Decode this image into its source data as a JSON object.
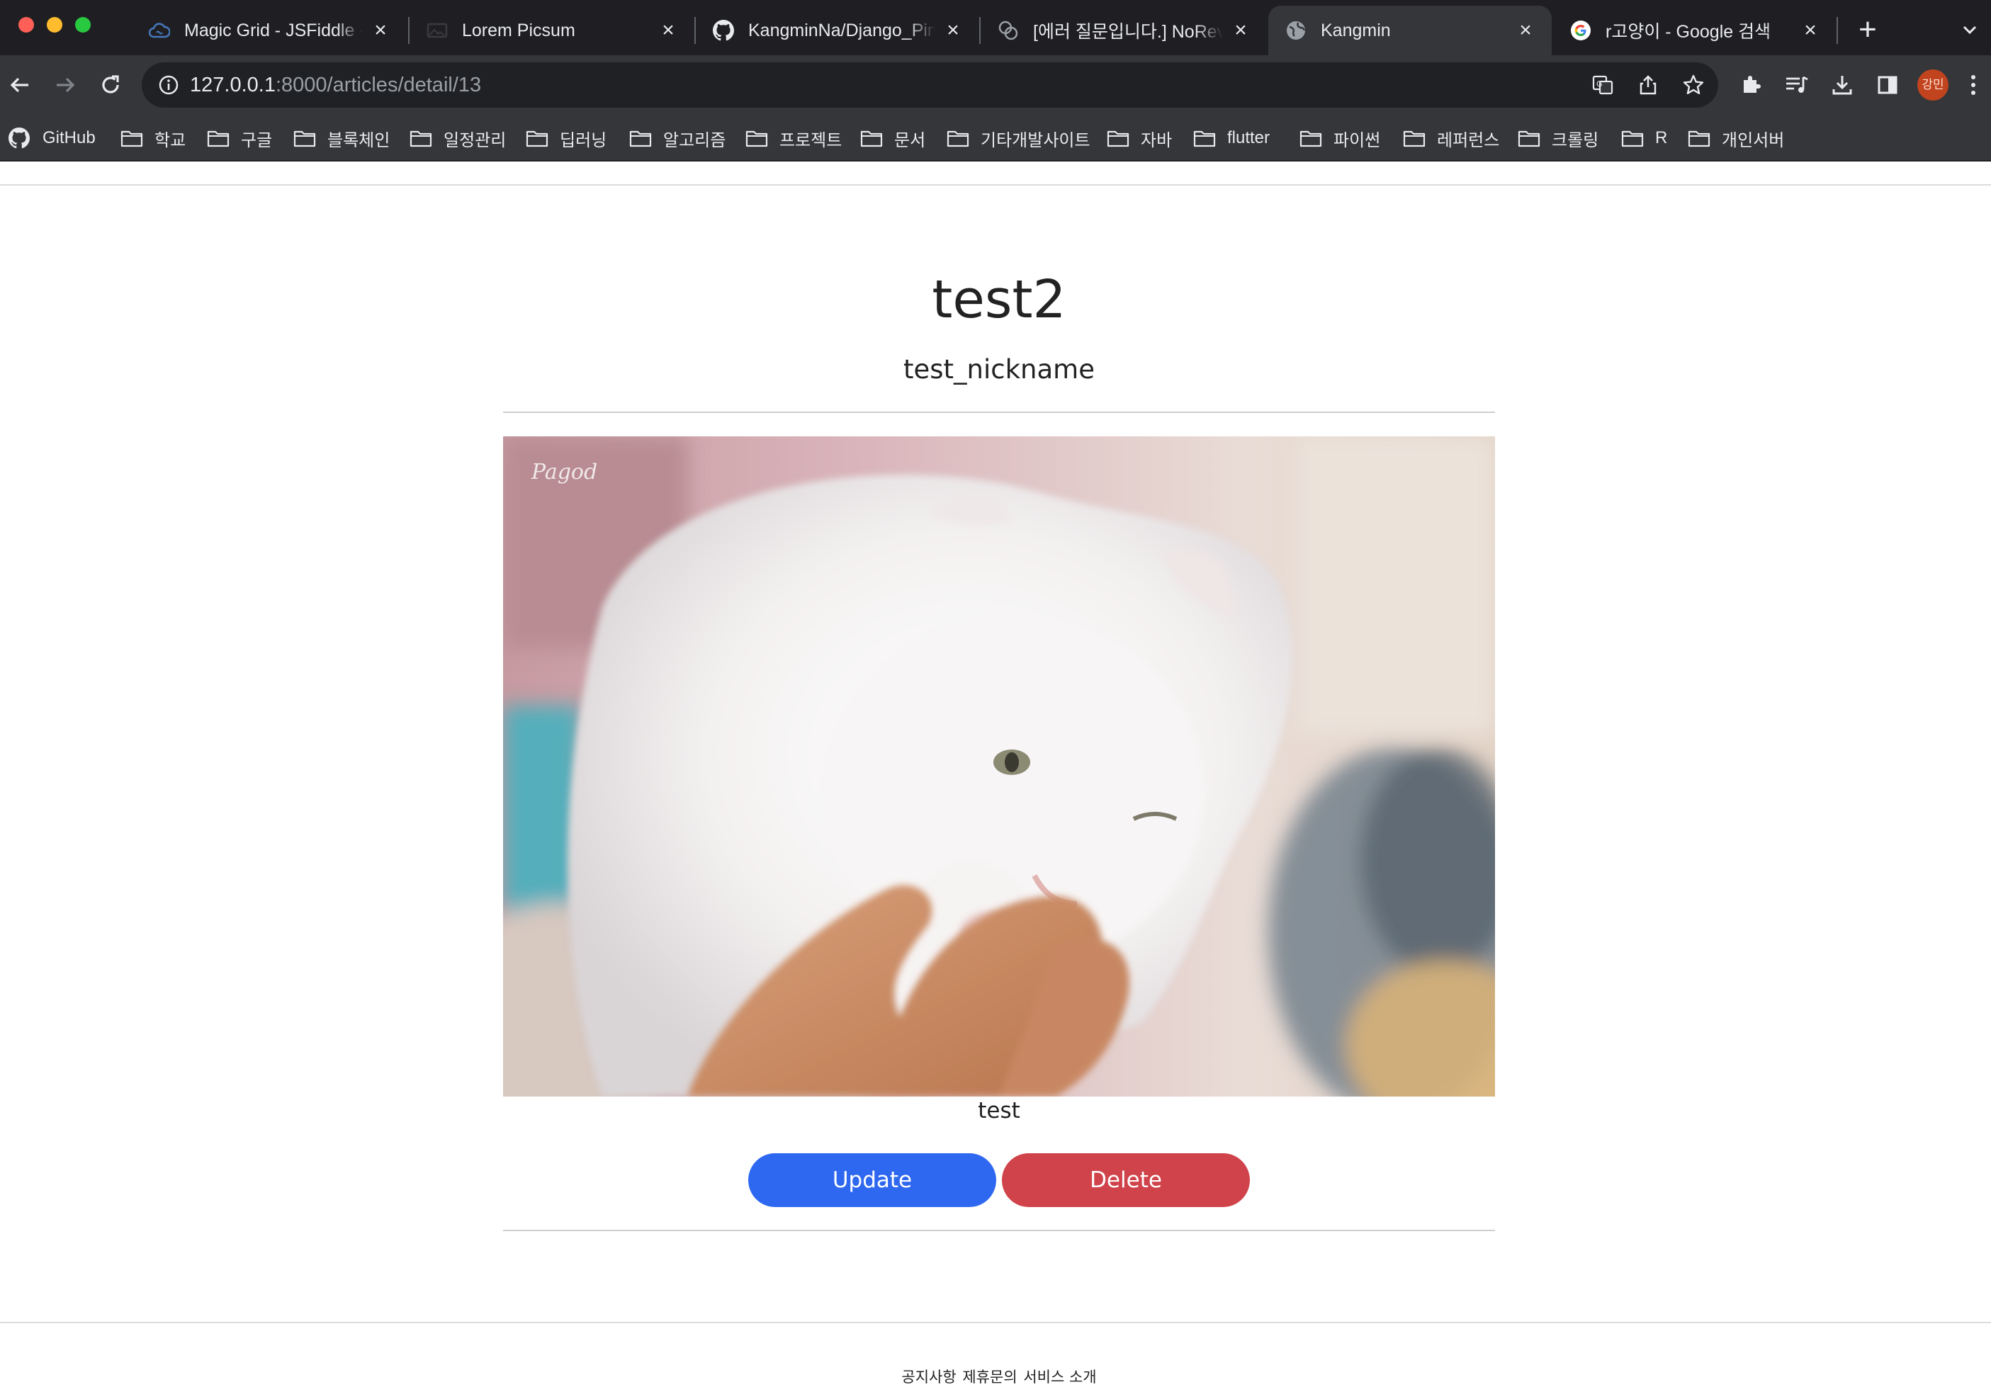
{
  "browser": {
    "tabs": [
      {
        "title": "Magic Grid - JSFiddle - Code Playground",
        "favicon": "jsfiddle-icon",
        "close": "×"
      },
      {
        "title": "Lorem Picsum",
        "favicon": "picsum-icon",
        "close": "×"
      },
      {
        "title": "KangminNa/Django_Pinterest",
        "favicon": "github-icon",
        "close": "×"
      },
      {
        "title": "[에러 질문입니다.] NoReverseMatch",
        "favicon": "translate-icon",
        "close": "×"
      },
      {
        "title": "Kangmin",
        "favicon": "globe-icon",
        "close": "×"
      },
      {
        "title": "r고양이 - Google 검색",
        "favicon": "google-icon",
        "close": "×"
      }
    ],
    "new_tab": "+",
    "url_host": "127.0.0.1",
    "url_rest": ":8000/articles/detail/13",
    "profile_initials": "강민",
    "bookmarks": [
      {
        "label": "GitHub",
        "icon": "github-icon"
      },
      {
        "label": "학교",
        "icon": "folder-icon"
      },
      {
        "label": "구글",
        "icon": "folder-icon"
      },
      {
        "label": "블록체인",
        "icon": "folder-icon"
      },
      {
        "label": "일정관리",
        "icon": "folder-icon"
      },
      {
        "label": "딥러닝",
        "icon": "folder-icon"
      },
      {
        "label": "알고리즘",
        "icon": "folder-icon"
      },
      {
        "label": "프로젝트",
        "icon": "folder-icon"
      },
      {
        "label": "문서",
        "icon": "folder-icon"
      },
      {
        "label": "기타개발사이트",
        "icon": "folder-icon"
      },
      {
        "label": "자바",
        "icon": "folder-icon"
      },
      {
        "label": "flutter",
        "icon": "folder-icon"
      },
      {
        "label": "파이썬",
        "icon": "folder-icon"
      },
      {
        "label": "레퍼런스",
        "icon": "folder-icon"
      },
      {
        "label": "크롤링",
        "icon": "folder-icon"
      },
      {
        "label": "R",
        "icon": "folder-icon"
      },
      {
        "label": "개인서버",
        "icon": "folder-icon"
      }
    ]
  },
  "article": {
    "title": "test2",
    "nickname": "test_nickname",
    "image_subject": "white-cat-photo",
    "content": "test",
    "update_label": "Update",
    "delete_label": "Delete"
  },
  "footer": {
    "links": [
      "공지사항",
      "제휴문의",
      "서비스 소개"
    ]
  },
  "colors": {
    "update": "#2f68f0",
    "delete": "#d0434a",
    "chrome_dark": "#1f1f23",
    "chrome_toolbar": "#35363a"
  }
}
